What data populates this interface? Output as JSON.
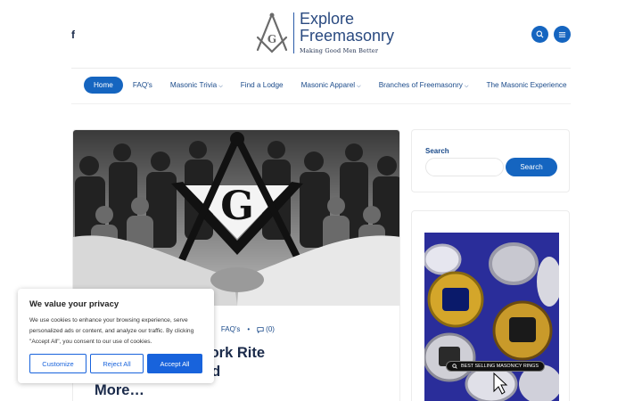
{
  "header": {
    "social_icon": "facebook-icon",
    "logo": {
      "line1": "Explore",
      "line2": "Freemasonry",
      "tagline": "Making Good Men Better"
    },
    "search_icon": "search-icon",
    "menu_icon": "menu-icon"
  },
  "nav": {
    "items": [
      {
        "label": "Home",
        "active": true,
        "dropdown": false
      },
      {
        "label": "FAQ's",
        "active": false,
        "dropdown": false
      },
      {
        "label": "Masonic Trivia",
        "active": false,
        "dropdown": true
      },
      {
        "label": "Find a Lodge",
        "active": false,
        "dropdown": false
      },
      {
        "label": "Masonic Apparel",
        "active": false,
        "dropdown": true
      },
      {
        "label": "Branches of Freemasonry",
        "active": false,
        "dropdown": true
      },
      {
        "label": "The Masonic Experience",
        "active": false,
        "dropdown": false
      }
    ],
    "caret": "⌵"
  },
  "article": {
    "meta_sep": "•",
    "category": "FAQ's",
    "comments": "(0)",
    "title_visible": "w to Become a York Rite\nites, Benefits, and\nMore…"
  },
  "sidebar": {
    "search_label": "Search",
    "search_placeholder": "",
    "search_button": "Search",
    "ad_text": "BEST SELLING MASONICY RINGS"
  },
  "cookie": {
    "title": "We value your privacy",
    "body": "We use cookies to enhance your browsing experience, serve personalized ads or content, and analyze our traffic. By clicking \"Accept All\", you consent to our use of cookies.",
    "customize": "Customize",
    "reject": "Reject All",
    "accept": "Accept All"
  },
  "colors": {
    "accent": "#1565c0",
    "navy": "#1a2a4a",
    "cookie_blue": "#1863dc"
  }
}
